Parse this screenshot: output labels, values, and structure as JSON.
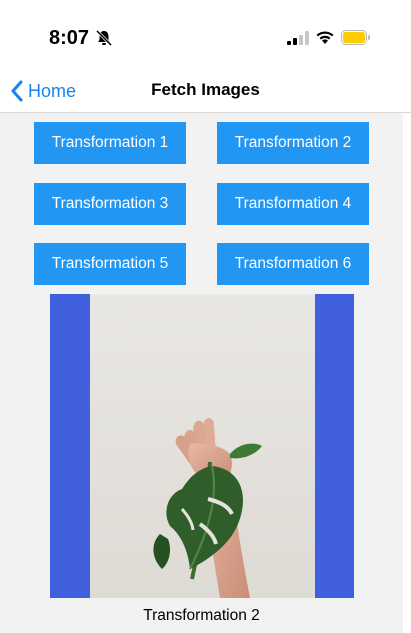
{
  "status_bar": {
    "time": "8:07",
    "icons": [
      "bell-slash-icon",
      "signal-icon",
      "wifi-icon",
      "battery-icon"
    ],
    "battery_color": "#ffcc00"
  },
  "nav": {
    "back_label": "Home",
    "title": "Fetch Images"
  },
  "buttons": [
    {
      "label": "Transformation 1"
    },
    {
      "label": "Transformation 2"
    },
    {
      "label": "Transformation 3"
    },
    {
      "label": "Transformation 4"
    },
    {
      "label": "Transformation 5"
    },
    {
      "label": "Transformation 6"
    }
  ],
  "image": {
    "caption": "Transformation 2",
    "frame_color": "#4060dd"
  },
  "colors": {
    "accent": "#2196f3",
    "link": "#1a82ea",
    "content_bg": "#f2f2f2"
  }
}
